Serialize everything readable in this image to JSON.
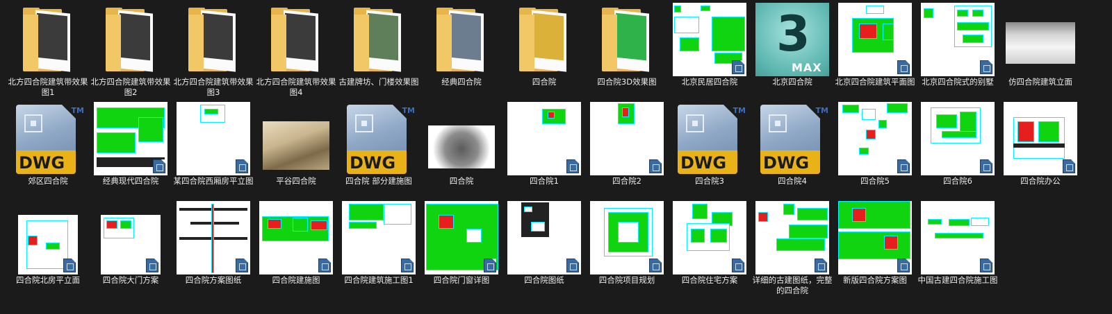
{
  "files": [
    {
      "label": "北方四合院建筑带效果图1",
      "kind": "folder",
      "art": "#3b3b3b"
    },
    {
      "label": "北方四合院建筑带效果图2",
      "kind": "folder",
      "art": "#3b3b3b"
    },
    {
      "label": "北方四合院建筑带效果图3",
      "kind": "folder",
      "art": "#3b3b3b"
    },
    {
      "label": "北方四合院建筑带效果图4",
      "kind": "folder",
      "art": "#3b3b3b"
    },
    {
      "label": "古建牌坊、门楼效果图",
      "kind": "folder",
      "art": "#5f7f5a"
    },
    {
      "label": "经典四合院",
      "kind": "folder",
      "art": "#6b7d8f"
    },
    {
      "label": "四合院",
      "kind": "folder",
      "art": "#dcb13a"
    },
    {
      "label": "四合院3D效果图",
      "kind": "folder",
      "art": "#2fb24a"
    },
    {
      "label": "北京民居四合院",
      "kind": "doc"
    },
    {
      "label": "北京四合院",
      "kind": "max",
      "icon_text": "3",
      "icon_sub": "MAX"
    },
    {
      "label": "北京四合院建筑平面图",
      "kind": "doc"
    },
    {
      "label": "北京四合院式的别墅",
      "kind": "doc"
    },
    {
      "label": "仿四合院建筑立面",
      "kind": "photo"
    },
    {
      "label": "郊区四合院",
      "kind": "dwg",
      "icon_text": "DWG",
      "tm": "TM"
    },
    {
      "label": "经典现代四合院",
      "kind": "doc"
    },
    {
      "label": "某四合院西厢房平立图",
      "kind": "doc"
    },
    {
      "label": "平谷四合院",
      "kind": "photo"
    },
    {
      "label": "四合院 部分建施图",
      "kind": "dwg",
      "icon_text": "DWG",
      "tm": "TM"
    },
    {
      "label": "四合院",
      "kind": "photo"
    },
    {
      "label": "四合院1",
      "kind": "doc"
    },
    {
      "label": "四合院2",
      "kind": "doc"
    },
    {
      "label": "四合院3",
      "kind": "dwg",
      "icon_text": "DWG",
      "tm": "TM"
    },
    {
      "label": "四合院4",
      "kind": "dwg",
      "icon_text": "DWG",
      "tm": "TM"
    },
    {
      "label": "四合院5",
      "kind": "doc"
    },
    {
      "label": "四合院6",
      "kind": "doc"
    },
    {
      "label": "四合院办公",
      "kind": "doc"
    },
    {
      "label": "四合院北房平立面",
      "kind": "doc"
    },
    {
      "label": "四合院大门方案",
      "kind": "doc"
    },
    {
      "label": "四合院方案图纸",
      "kind": "doc"
    },
    {
      "label": "四合院建施图",
      "kind": "doc"
    },
    {
      "label": "四合院建筑施工图1",
      "kind": "doc"
    },
    {
      "label": "四合院门窗详图",
      "kind": "doc"
    },
    {
      "label": "四合院图纸",
      "kind": "doc"
    },
    {
      "label": "四合院项目规划",
      "kind": "doc"
    },
    {
      "label": "四合院住宅方案",
      "kind": "doc"
    },
    {
      "label": "详细的古建图纸，完整的四合院",
      "kind": "doc"
    },
    {
      "label": "新版四合院方案图",
      "kind": "doc"
    },
    {
      "label": "中国古建四合院施工图",
      "kind": "doc"
    }
  ]
}
